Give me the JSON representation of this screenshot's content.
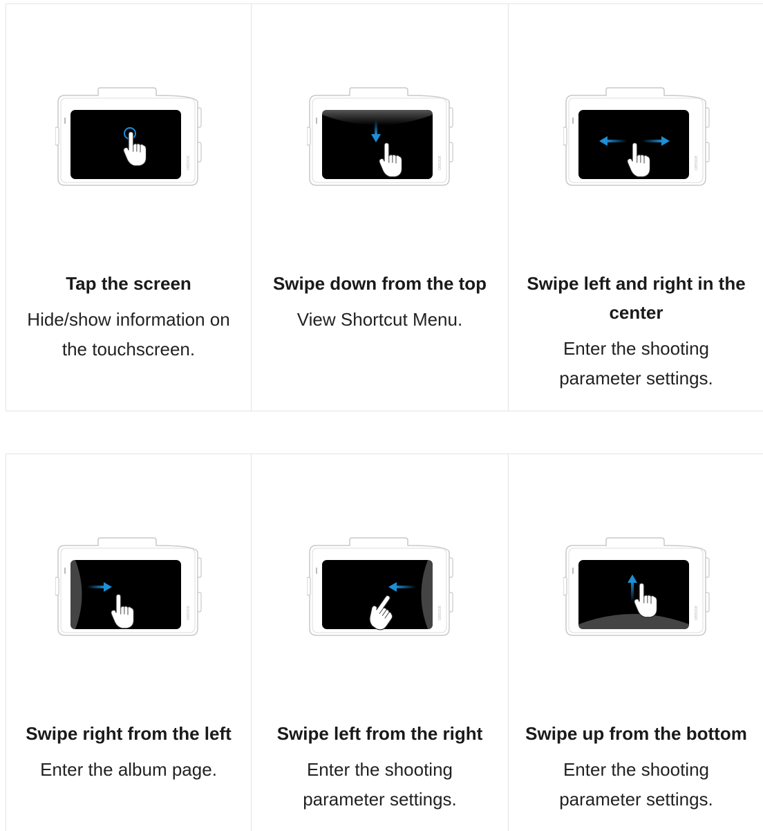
{
  "colors": {
    "accent": "#1e8fd6",
    "screen": "#000000",
    "outline": "#c8c8c8",
    "divider": "#e4e4e4"
  },
  "gestures": [
    {
      "title": "Tap the screen",
      "description": "Hide/show information on the touchscreen.",
      "icon": "tap-icon"
    },
    {
      "title": "Swipe down from the top",
      "description": "View Shortcut Menu.",
      "icon": "swipe-down-icon"
    },
    {
      "title": "Swipe left and right in the center",
      "description": "Enter the shooting parameter settings.",
      "icon": "swipe-left-right-icon"
    },
    {
      "title": "Swipe right from the left",
      "description": "Enter the album page.",
      "icon": "swipe-right-icon"
    },
    {
      "title": "Swipe left from the right",
      "description": "Enter the shooting parameter settings.",
      "icon": "swipe-left-icon"
    },
    {
      "title": "Swipe up from the bottom",
      "description": "Enter the shooting parameter settings.",
      "icon": "swipe-up-icon"
    }
  ]
}
